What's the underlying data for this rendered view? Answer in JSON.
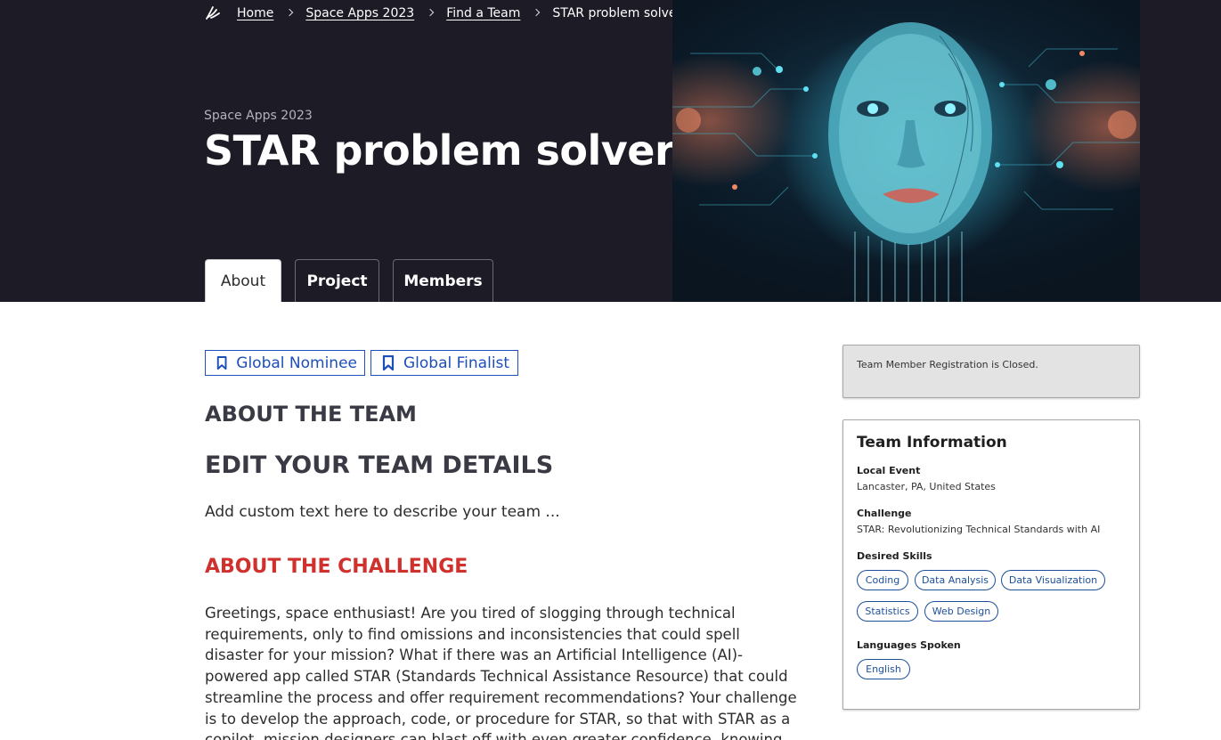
{
  "breadcrumb": {
    "items": [
      "Home",
      "Space Apps 2023",
      "Find a Team"
    ],
    "current": "STAR problem solvers"
  },
  "hero": {
    "eyebrow": "Space Apps 2023",
    "title": "STAR problem solvers"
  },
  "tabs": [
    "About",
    "Project",
    "Members"
  ],
  "badges": [
    "Global Nominee",
    "Global Finalist"
  ],
  "about": {
    "heading": "ABOUT THE TEAM",
    "edit_heading": "EDIT YOUR TEAM DETAILS",
    "custom_text": "Add custom text here to describe your team ...",
    "challenge_heading": "ABOUT THE CHALLENGE",
    "challenge_text": "Greetings, space enthusiast! Are you tired of slogging through technical requirements, only to find omissions and inconsistencies that could spell disaster for your mission? What if there was an Artificial Intelligence (AI)-powered app called STAR (Standards Technical Assistance Resource) that could streamline the process and offer requirement recommendations? Your challenge is to develop the approach, code, or procedure for STAR, so that with STAR as a copilot, mission designers can blast off with even greater confidence, knowing"
  },
  "sidebar": {
    "registration_status": "Team Member Registration is Closed.",
    "team_info": {
      "title": "Team Information",
      "local_event_label": "Local Event",
      "local_event": "Lancaster, PA, United States",
      "challenge_label": "Challenge",
      "challenge": "STAR: Revolutionizing Technical Standards with AI",
      "skills_label": "Desired Skills",
      "skills": [
        "Coding",
        "Data Analysis",
        "Data Visualization",
        "Statistics",
        "Web Design"
      ],
      "languages_label": "Languages Spoken",
      "languages": [
        "English"
      ]
    }
  },
  "colors": {
    "hero_bg": "#1c1b26",
    "badge_blue": "#1d4fb8",
    "challenge_red": "#d0312d",
    "chip_blue": "#1d4f9a"
  }
}
